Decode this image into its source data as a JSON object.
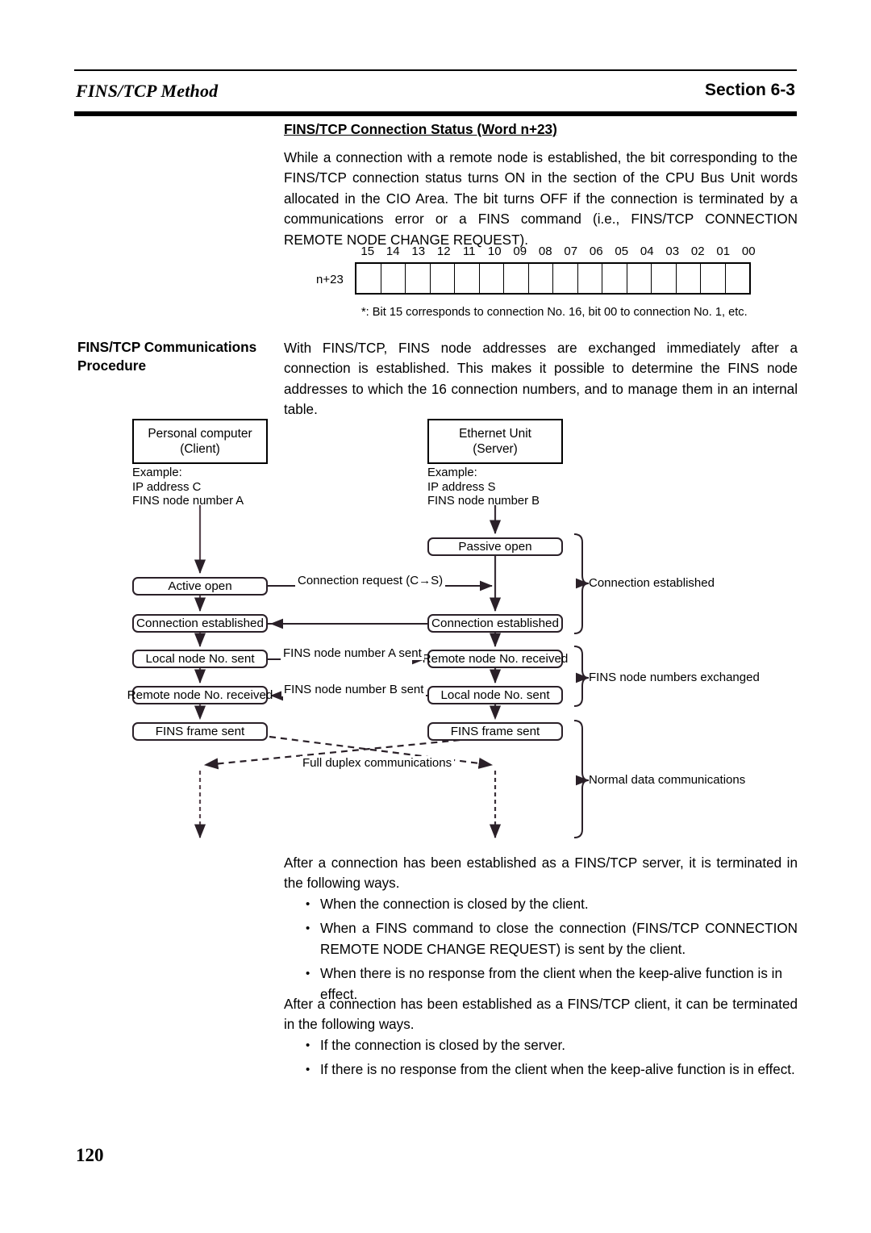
{
  "header": {
    "title": "FINS/TCP Method",
    "section": "Section 6-3"
  },
  "subhead": "FINS/TCP Connection Status (Word n+23)",
  "intro_paragraph": "While a connection with a remote node is established, the bit corresponding to the FINS/TCP connection status turns ON in the section of the CPU Bus Unit words allocated in the CIO Area. The bit turns OFF if the connection is terminated by a communications error or a FINS command (i.e., FINS/TCP CONNECTION REMOTE NODE CHANGE REQUEST).",
  "bitmap": {
    "word_label": "n+23",
    "bit_numbers": [
      "15",
      "14",
      "13",
      "12",
      "11",
      "10",
      "09",
      "08",
      "07",
      "06",
      "05",
      "04",
      "03",
      "02",
      "01",
      "00"
    ],
    "note": "*: Bit 15 corresponds to connection No. 16, bit 00 to connection No. 1, etc."
  },
  "margin_heading": "FINS/TCP Communications Procedure",
  "procedure_paragraph": "With FINS/TCP, FINS node addresses are exchanged immediately after a connection is established. This makes it possible to determine the FINS node addresses to which the 16 connection numbers, and to manage them in an internal table.",
  "diagram": {
    "client_node": {
      "title_line1": "Personal computer",
      "title_line2": "(Client)",
      "example_line1": "Example:",
      "example_line2": "IP address C",
      "example_line3": "FINS node number A"
    },
    "server_node": {
      "title_line1": "Ethernet Unit",
      "title_line2": "(Server)",
      "example_line1": "Example:",
      "example_line2": "IP address S",
      "example_line3": "FINS node number B"
    },
    "states": {
      "active_open": "Active open",
      "passive_open": "Passive open",
      "connection_established": "Connection established",
      "local_node_sent": "Local node No. sent",
      "remote_node_received": "Remote node No. received",
      "fins_frame_sent": "FINS frame sent"
    },
    "flow_labels": {
      "connection_request": "Connection request (C→S)",
      "node_a_sent": "FINS node number A sent",
      "node_b_sent": "FINS node number B sent",
      "full_duplex": "Full duplex communications"
    },
    "brace_labels": {
      "connection_established": "Connection established",
      "node_numbers_exchanged": "FINS node numbers exchanged",
      "normal_data": "Normal data communications"
    }
  },
  "after_server_paragraph": "After a connection has been established as a FINS/TCP server, it is terminated in the following ways.",
  "server_bullets": [
    "When the connection is closed by the client.",
    "When a FINS command to close the connection (FINS/TCP CONNECTION REMOTE NODE CHANGE REQUEST) is sent by the client.",
    "When there is no response from the client when the keep-alive function is in effect."
  ],
  "after_client_paragraph": "After a connection has been established as a FINS/TCP client, it can be terminated in the following ways.",
  "client_bullets": [
    "If the connection is closed by the server.",
    "If there is no response from the client when the keep-alive function is in effect."
  ],
  "page_number": "120"
}
